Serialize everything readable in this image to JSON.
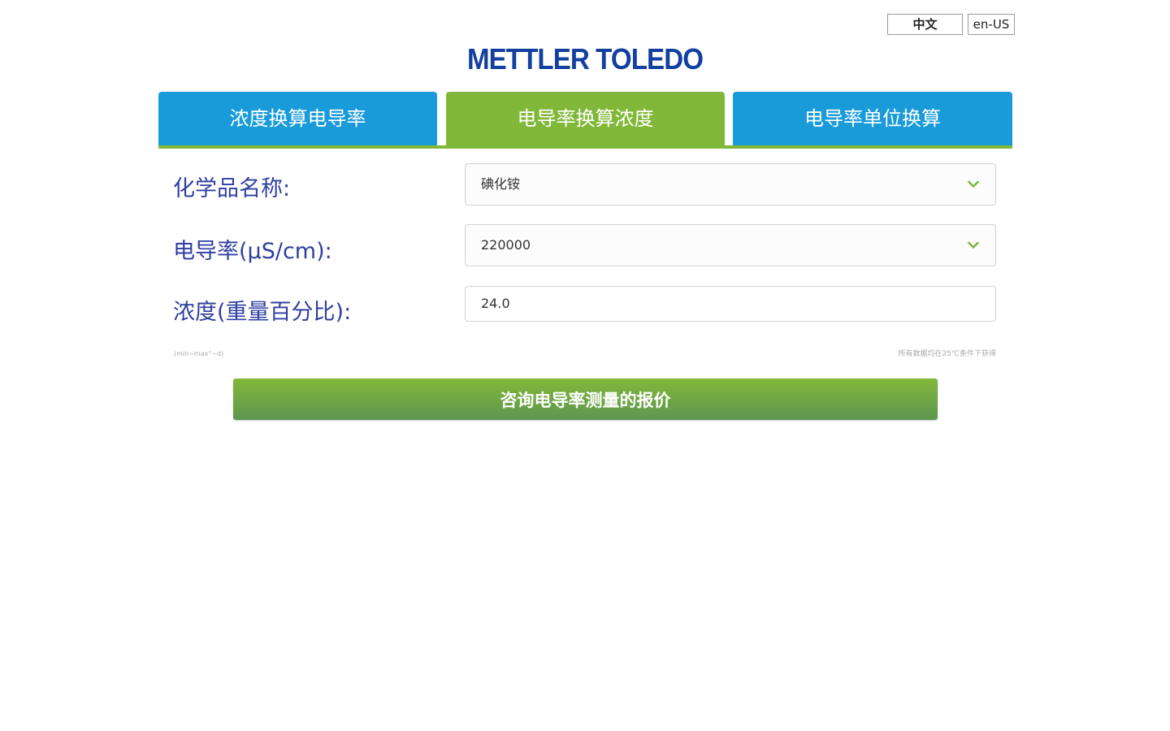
{
  "lang": {
    "zh_label": "中文",
    "en_label": "en-US"
  },
  "logo": {
    "text": "METTLER TOLEDO"
  },
  "tabs": [
    {
      "label": "浓度换算电导率",
      "active": false
    },
    {
      "label": "电导率换算浓度",
      "active": true
    },
    {
      "label": "电导率单位换算",
      "active": false
    }
  ],
  "form": {
    "chemical": {
      "label": "化学品名称:",
      "value": "碘化铵"
    },
    "conductivity": {
      "label": "电导率(μS/cm):",
      "value": "220000"
    },
    "concentration": {
      "label": "浓度(重量百分比):",
      "value": "24.0"
    }
  },
  "notes": {
    "left": "(min~max°~d)",
    "right": "所有数据均在25℃条件下获得"
  },
  "quote_button": {
    "label": "咨询电导率测量的报价"
  },
  "colors": {
    "tab_blue": "#1a9bd9",
    "tab_green": "#82b83a",
    "label_text": "#2f3fa0",
    "logo_blue": "#123fa0",
    "chevron_green": "#82b83a"
  }
}
